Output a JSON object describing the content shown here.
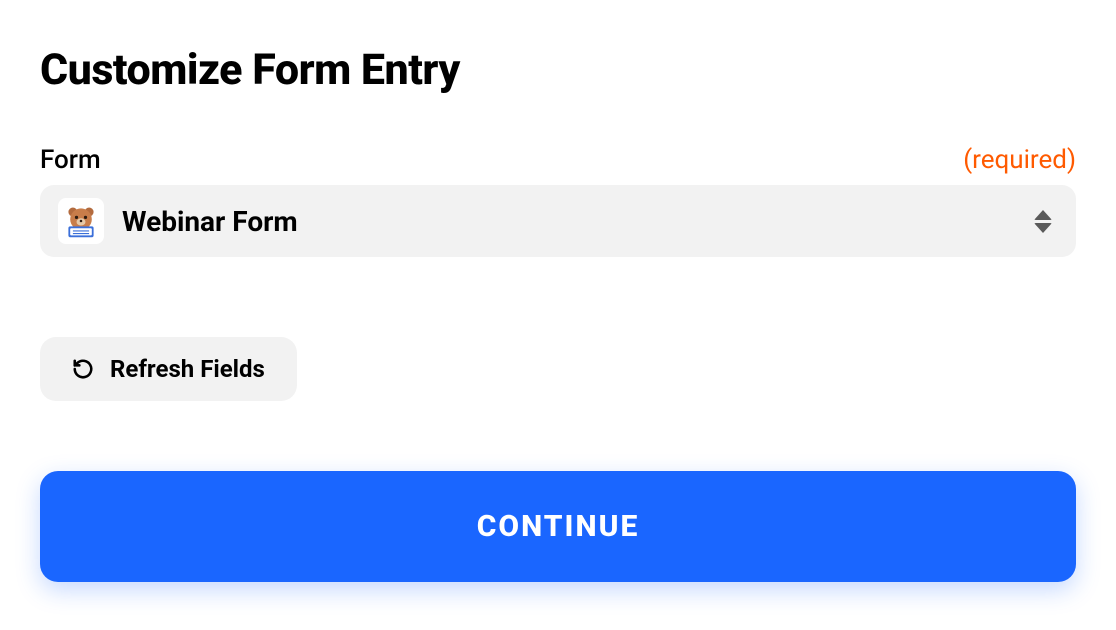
{
  "title": "Customize Form Entry",
  "form": {
    "label": "Form",
    "required_tag": "(required)",
    "selected": "Webinar Form",
    "icon": "wpforms-bear-icon"
  },
  "actions": {
    "refresh_label": "Refresh Fields",
    "continue_label": "CONTINUE"
  }
}
